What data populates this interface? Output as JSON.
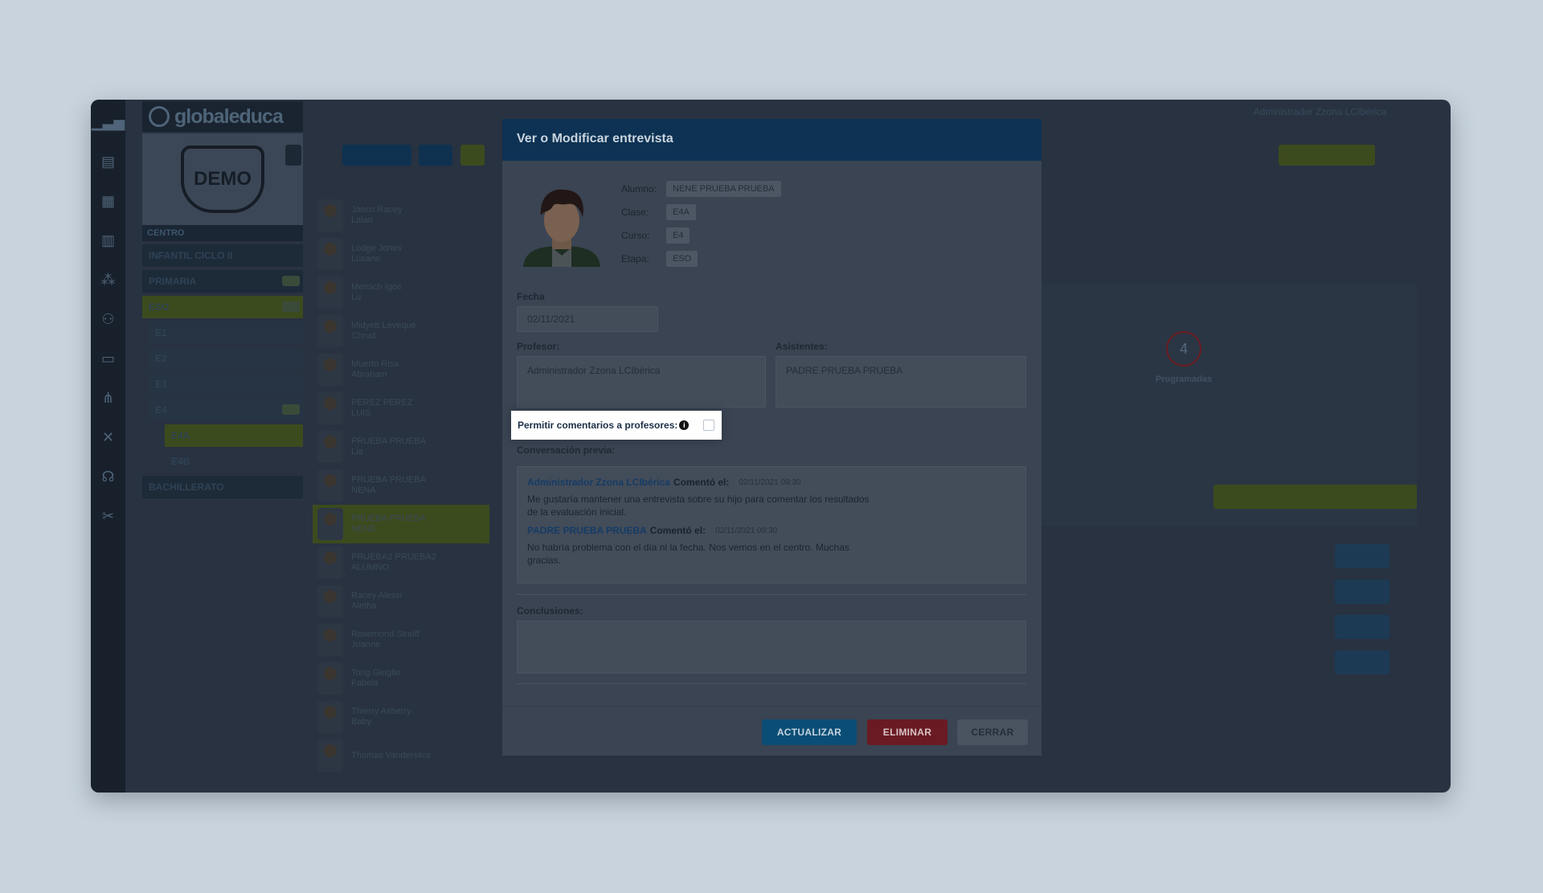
{
  "app": {
    "logo_text": "globaleduca",
    "demo_label": "DEMO",
    "centro_label": "CENTRO",
    "tree": [
      "INFANTIL CICLO II",
      "PRIMARIA",
      "ESO",
      "E1",
      "E2",
      "E3",
      "E4",
      "E4A",
      "E4B",
      "BACHILLERATO"
    ],
    "students": [
      {
        "name": "Jaeco Racey",
        "sub": "Lalan"
      },
      {
        "name": "Lodge Jones",
        "sub": "Lusano"
      },
      {
        "name": "Mensch Igoe",
        "sub": "Lu"
      },
      {
        "name": "Midyett Leveque",
        "sub": "Chrud"
      },
      {
        "name": "Muerto Risa",
        "sub": "Abraham"
      },
      {
        "name": "PEREZ PEREZ",
        "sub": "LUIS"
      },
      {
        "name": "PRUEBA PRUEBA",
        "sub": "Lia"
      },
      {
        "name": "PRUEBA PRUEBA",
        "sub": "NENA"
      },
      {
        "name": "PRUEBA PRUEBA",
        "sub": "NENE"
      },
      {
        "name": "PRUEBA2 PRUEBA2",
        "sub": "ALUMNO"
      },
      {
        "name": "Racey Alessi",
        "sub": "Aletha"
      },
      {
        "name": "Rosemond Streiff",
        "sub": "Joanne"
      },
      {
        "name": "Tong Giuglio",
        "sub": "Fabela"
      },
      {
        "name": "Thierry Asberry",
        "sub": "Baby"
      },
      {
        "name": "Thomas Vanderslice",
        "sub": ""
      }
    ],
    "top_user": "Administrador Zzona LCIbérica",
    "programadas_count": "4",
    "programadas_label": "Programadas"
  },
  "modal": {
    "title": "Ver o Modificar entrevista",
    "student_info": {
      "alumno_label": "Alumno:",
      "alumno_value": "NENE PRUEBA PRUEBA",
      "clase_label": "Clase:",
      "clase_value": "E4A",
      "curso_label": "Curso:",
      "curso_value": "E4",
      "etapa_label": "Etapa:",
      "etapa_value": "ESO"
    },
    "fecha_label": "Fecha",
    "fecha_value": "02/11/2021",
    "profesor_label": "Profesor:",
    "profesor_value": "Administrador Zzona LCIbérica",
    "asistentes_label": "Asistentes:",
    "asistentes_value": "PADRE PRUEBA PRUEBA",
    "permitir_label": "Permitir comentarios a profesores:",
    "permitir_checked": false,
    "conversacion_label": "Conversación previa:",
    "comments": [
      {
        "author": "Administrador Zzona LCIbérica",
        "verb": "Comentó el:",
        "time": "02/11/2021 09:30",
        "text": "Me gustaría mantener una entrevista sobre su hijo para comentar los resultados de la evaluación inicial."
      },
      {
        "author": "PADRE PRUEBA PRUEBA",
        "verb": "Comentó el:",
        "time": "02/11/2021 09:30",
        "text": "No habría problema con el día ni la fecha. Nos vemos en el centro. Muchas gracias."
      }
    ],
    "conclusiones_label": "Conclusiones:",
    "conclusiones_value": "",
    "buttons": {
      "update": "ACTUALIZAR",
      "delete": "ELIMINAR",
      "close": "CERRAR"
    }
  }
}
